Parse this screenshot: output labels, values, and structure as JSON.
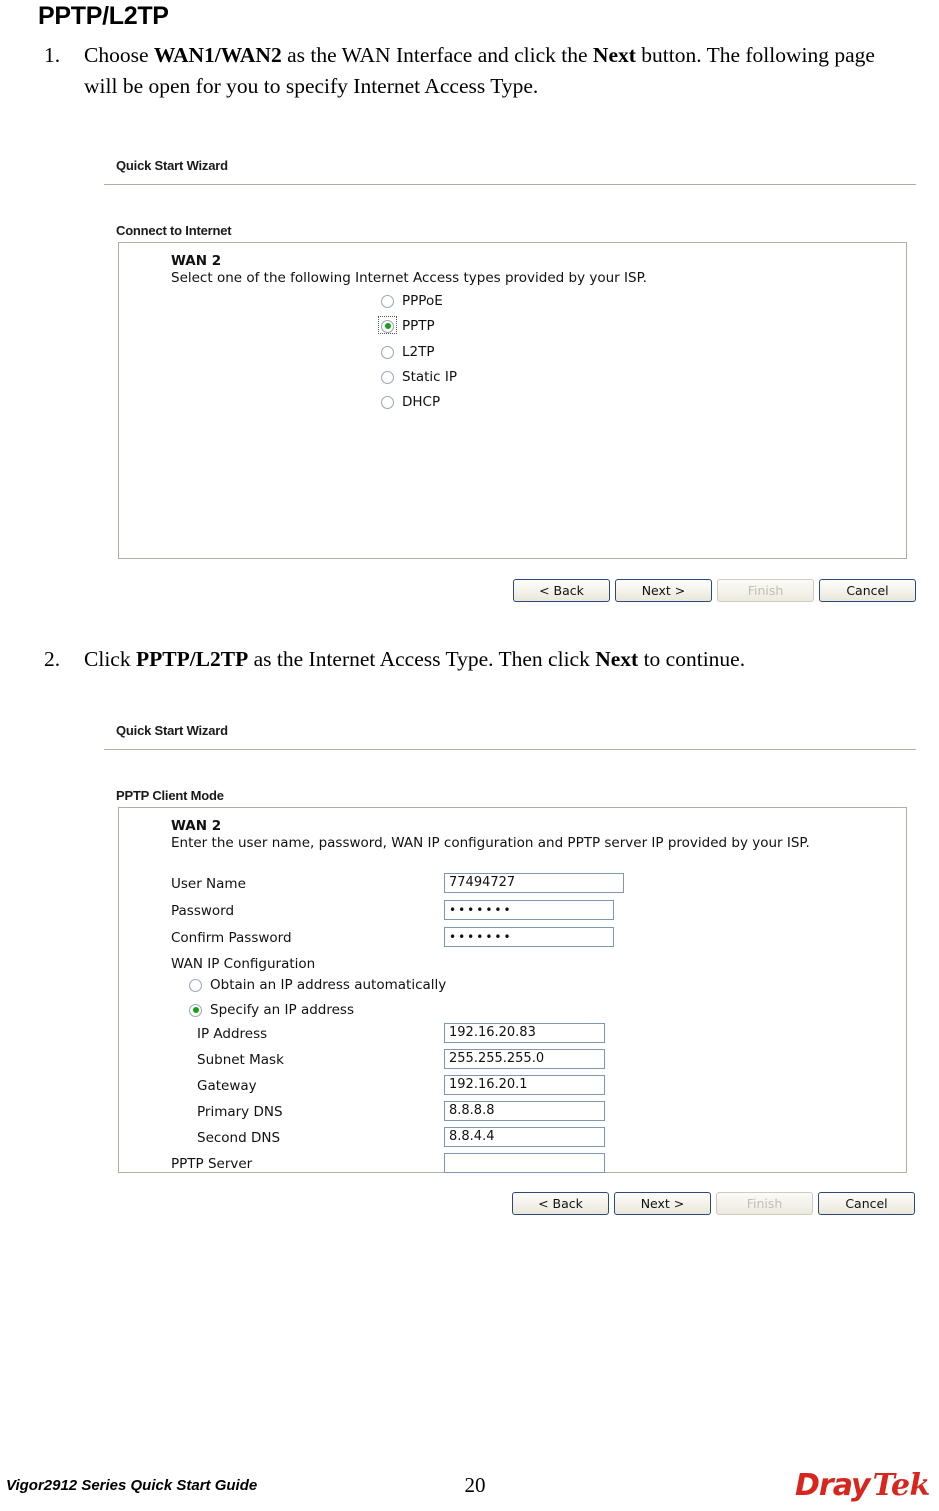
{
  "document": {
    "heading": "PPTP/L2TP",
    "steps": [
      {
        "number": "1.",
        "parts": [
          {
            "t": "Choose ",
            "b": false
          },
          {
            "t": "WAN1/WAN2",
            "b": true
          },
          {
            "t": " as the WAN Interface and click the ",
            "b": false
          },
          {
            "t": "Next",
            "b": true
          },
          {
            "t": " button. The following page will be open for you to specify Internet Access Type.",
            "b": false
          }
        ]
      },
      {
        "number": "2.",
        "parts": [
          {
            "t": "Click ",
            "b": false
          },
          {
            "t": "PPTP/L2TP",
            "b": true
          },
          {
            "t": " as the Internet Access Type. Then click ",
            "b": false
          },
          {
            "t": "Next",
            "b": true
          },
          {
            "t": " to continue.",
            "b": false
          }
        ]
      }
    ]
  },
  "screenshot1": {
    "title": "Quick Start Wizard",
    "section_label": "Connect to Internet",
    "wan_heading": "WAN 2",
    "wan_description": "Select one of the following Internet Access types provided by your ISP.",
    "access_types": [
      {
        "label": "PPPoE",
        "checked": false,
        "focused": false
      },
      {
        "label": "PPTP",
        "checked": true,
        "focused": true
      },
      {
        "label": "L2TP",
        "checked": false,
        "focused": false
      },
      {
        "label": "Static IP",
        "checked": false,
        "focused": false
      },
      {
        "label": "DHCP",
        "checked": false,
        "focused": false
      }
    ],
    "buttons": [
      {
        "label": "< Back",
        "disabled": false
      },
      {
        "label": "Next >",
        "disabled": false
      },
      {
        "label": "Finish",
        "disabled": true
      },
      {
        "label": "Cancel",
        "disabled": false
      }
    ]
  },
  "screenshot2": {
    "title": "Quick Start Wizard",
    "section_label": "PPTP Client Mode",
    "wan_heading": "WAN 2",
    "wan_description": "Enter the user name, password, WAN IP configuration and PPTP server IP provided by your ISP.",
    "fields": {
      "user_name_label": "User Name",
      "user_name_value": "77494727",
      "password_label": "Password",
      "password_value": "•••••••",
      "confirm_password_label": "Confirm Password",
      "confirm_password_value": "•••••••",
      "wan_ip_config_label": "WAN IP Configuration",
      "obtain_auto_label": "Obtain an IP address automatically",
      "specify_ip_label": "Specify an IP address",
      "ip_address_label": "IP Address",
      "ip_address_value": "192.16.20.83",
      "subnet_mask_label": "Subnet Mask",
      "subnet_mask_value": "255.255.255.0",
      "gateway_label": "Gateway",
      "gateway_value": "192.16.20.1",
      "primary_dns_label": "Primary DNS",
      "primary_dns_value": "8.8.8.8",
      "second_dns_label": "Second DNS",
      "second_dns_value": "8.8.4.4",
      "pptp_server_label": "PPTP Server",
      "pptp_server_value": ""
    },
    "wan_ip_mode": {
      "obtain_auto_checked": false,
      "specify_checked": true
    },
    "buttons": [
      {
        "label": "< Back",
        "disabled": false
      },
      {
        "label": "Next >",
        "disabled": false
      },
      {
        "label": "Finish",
        "disabled": true
      },
      {
        "label": "Cancel",
        "disabled": false
      }
    ]
  },
  "footer": {
    "left_text": "Vigor2912 Series Quick Start Guide",
    "page_number": "20",
    "logo_part1": "Dray",
    "logo_part2": "Tek",
    "logo_color": "#d7261e"
  }
}
